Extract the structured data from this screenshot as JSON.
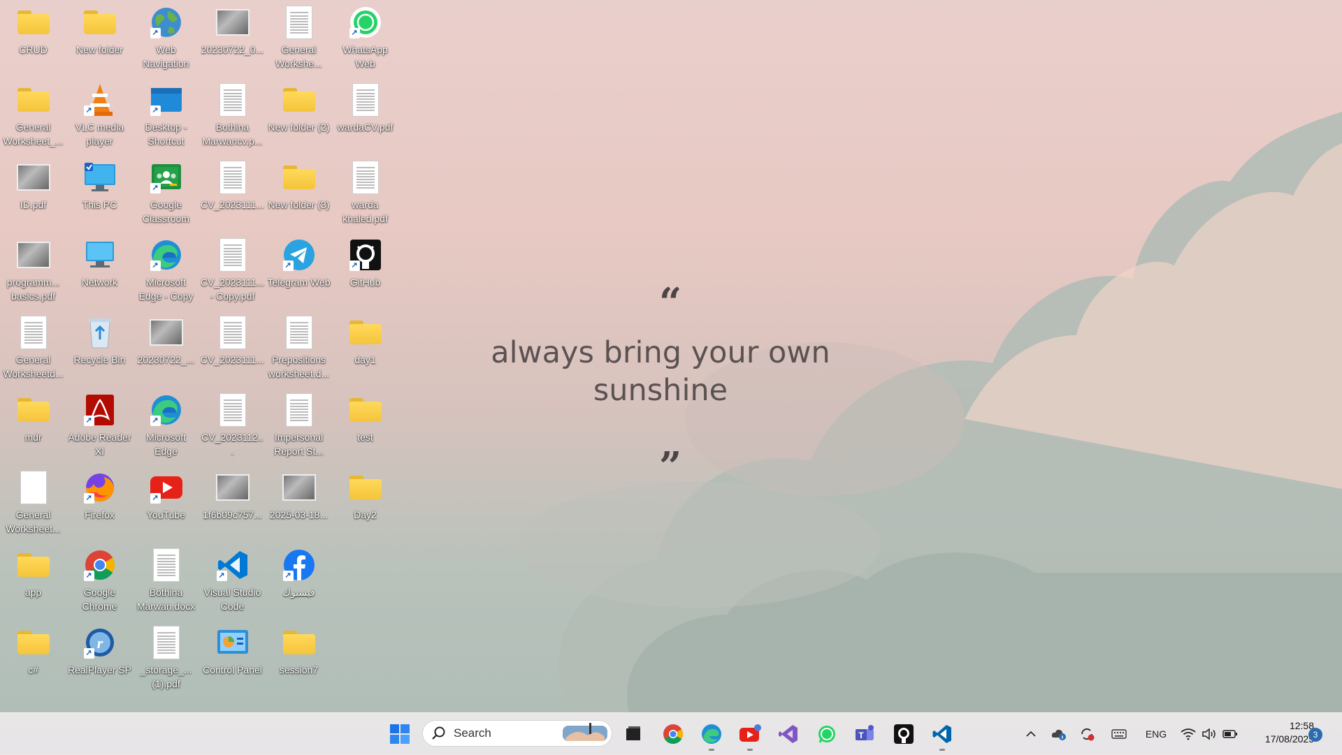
{
  "wallpaper": {
    "quote_open": "“",
    "quote_text": "always bring your own sunshine",
    "quote_close": "”"
  },
  "desktop_icons": [
    {
      "label": "CRUD",
      "type": "folder"
    },
    {
      "label": "General Worksheet_...",
      "type": "folder"
    },
    {
      "label": "ID.pdf",
      "type": "photo"
    },
    {
      "label": "programm... basics.pdf",
      "type": "photo"
    },
    {
      "label": "General Worksheetd...",
      "type": "doc"
    },
    {
      "label": "mdr",
      "type": "folder-user"
    },
    {
      "label": "General Worksheet...",
      "type": "doc-blank"
    },
    {
      "label": "app",
      "type": "folder"
    },
    {
      "label": "c#",
      "type": "folder"
    },
    {
      "label": "New folder",
      "type": "folder"
    },
    {
      "label": "VLC media player",
      "type": "vlc"
    },
    {
      "label": "This PC",
      "type": "pc"
    },
    {
      "label": "Network",
      "type": "network"
    },
    {
      "label": "Recycle Bin",
      "type": "recycle"
    },
    {
      "label": "Adobe Reader XI",
      "type": "adobe"
    },
    {
      "label": "Firefox",
      "type": "firefox"
    },
    {
      "label": "Google Chrome",
      "type": "chrome"
    },
    {
      "label": "RealPlayer SP",
      "type": "realplayer"
    },
    {
      "label": "Web Navigation",
      "type": "globe"
    },
    {
      "label": "Desktop - Shortcut",
      "type": "desktop"
    },
    {
      "label": "Google Classroom",
      "type": "classroom"
    },
    {
      "label": "Microsoft Edge - Copy",
      "type": "edge"
    },
    {
      "label": "20230722_...",
      "type": "photo"
    },
    {
      "label": "Microsoft Edge",
      "type": "edge"
    },
    {
      "label": "YouTube",
      "type": "youtube"
    },
    {
      "label": "Bothina Marwan.docx",
      "type": "doc"
    },
    {
      "label": "_storage_... (1).pdf",
      "type": "doc"
    },
    {
      "label": "20230722_0...",
      "type": "photo"
    },
    {
      "label": "Bothina Marwancv.p...",
      "type": "doc"
    },
    {
      "label": "CV_2023111...",
      "type": "doc"
    },
    {
      "label": "CV_2023111... - Copy.pdf",
      "type": "doc"
    },
    {
      "label": "CV_2023111...",
      "type": "doc"
    },
    {
      "label": "CV_2023112...",
      "type": "doc"
    },
    {
      "label": "1f6b09c757...",
      "type": "photo"
    },
    {
      "label": "Visual Studio Code",
      "type": "vscode"
    },
    {
      "label": "Control Panel",
      "type": "controlpanel"
    },
    {
      "label": "General Workshe...",
      "type": "doc"
    },
    {
      "label": "New folder (2)",
      "type": "folder"
    },
    {
      "label": "New folder (3)",
      "type": "folder"
    },
    {
      "label": "Telegram Web",
      "type": "telegram"
    },
    {
      "label": "Prepositions worksheet.d...",
      "type": "doc"
    },
    {
      "label": "Impersonal Report St...",
      "type": "doc"
    },
    {
      "label": "2025-03-18...",
      "type": "photo"
    },
    {
      "label": "فيسبوك",
      "type": "facebook"
    },
    {
      "label": "session7",
      "type": "folder"
    },
    {
      "label": "WhatsApp Web",
      "type": "whatsapp"
    },
    {
      "label": "wardaCV.pdf",
      "type": "doc"
    },
    {
      "label": "warda khaled.pdf",
      "type": "doc"
    },
    {
      "label": "GitHub",
      "type": "github"
    },
    {
      "label": "day1",
      "type": "folder"
    },
    {
      "label": "test",
      "type": "folder"
    },
    {
      "label": "Day2",
      "type": "folder"
    }
  ],
  "taskbar": {
    "search_placeholder": "Search",
    "language": "ENG",
    "time": "12:58",
    "date": "17/08/2025",
    "notification_count": "3"
  }
}
